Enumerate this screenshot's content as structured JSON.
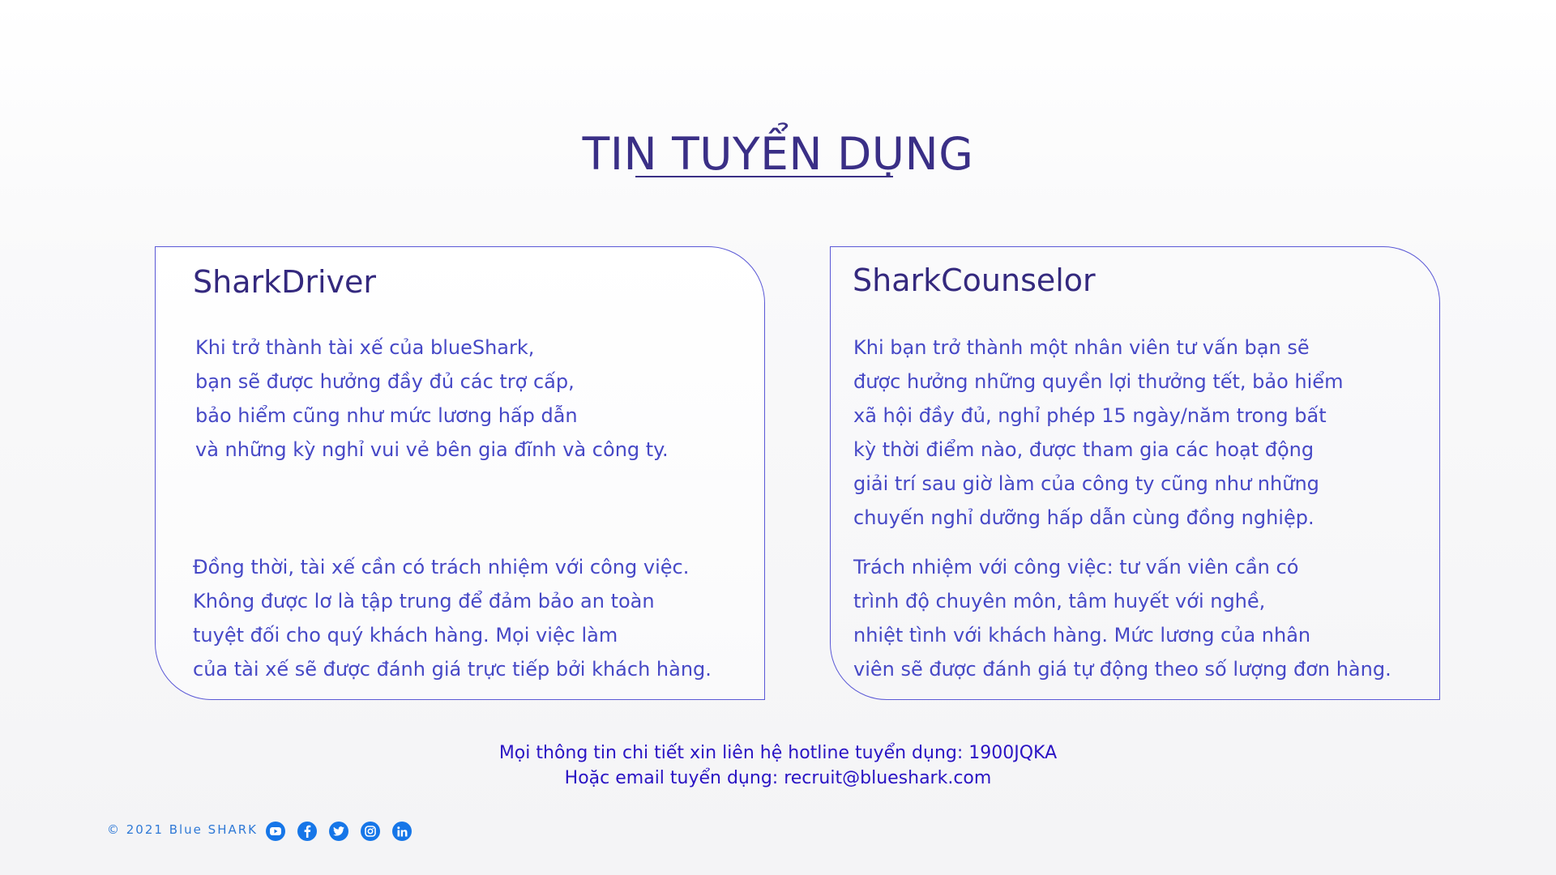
{
  "page": {
    "title": "TIN TUYỂN DỤNG"
  },
  "cards": [
    {
      "title": "SharkDriver",
      "paragraphs": [
        [
          "Khi trở thành tài xế của blueShark,",
          "bạn sẽ được hưởng đầy đủ các trợ cấp,",
          "bảo hiểm cũng như mức lương hấp dẫn",
          "và những kỳ nghỉ vui vẻ bên gia đĩnh và công ty."
        ],
        [
          "Đồng thời, tài xế cần có trách nhiệm với công việc.",
          "Không được lơ là tập trung để đảm bảo an toàn",
          "tuyệt đối cho quý khách hàng. Mọi việc làm",
          "của tài xế sẽ được đánh giá trực tiếp bởi khách hàng."
        ]
      ]
    },
    {
      "title": "SharkCounselor",
      "paragraphs": [
        [
          "Khi bạn trở thành một nhân viên tư vấn bạn sẽ",
          "được hưởng những quyền lợi thưởng tết, bảo hiểm",
          "xã hội đầy đủ, nghỉ phép 15 ngày/năm trong bất",
          "kỳ thời điểm nào, được tham gia các hoạt động",
          "giải trí sau giờ làm của công ty cũng như những",
          "chuyến nghỉ dưỡng hấp dẫn cùng đồng nghiệp."
        ],
        [
          "Trách nhiệm với công việc: tư vấn viên cần có",
          "trình độ chuyên môn, tâm huyết với nghề,",
          "nhiệt tình với khách hàng. Mức lương của nhân",
          "viên sẽ được đánh giá tự động theo số lượng đơn hàng."
        ]
      ]
    }
  ],
  "contact": {
    "hotline_line": "Mọi thông tin chi tiết xin liên hệ hotline tuyển dụng: 1900JQKA",
    "email_line": "Hoặc email tuyển dụng: recruit@blueshark.com"
  },
  "footer": {
    "copyright": "© 2021 Blue SHARK",
    "socials": [
      "youtube-icon",
      "facebook-icon",
      "twitter-icon",
      "instagram-icon",
      "linkedin-icon"
    ],
    "social_color": "#1676e8"
  },
  "colors": {
    "title": "#3a2f86",
    "card_border": "#5a58d6",
    "body_text": "#4648c6",
    "contact_text": "#2a14c4"
  }
}
